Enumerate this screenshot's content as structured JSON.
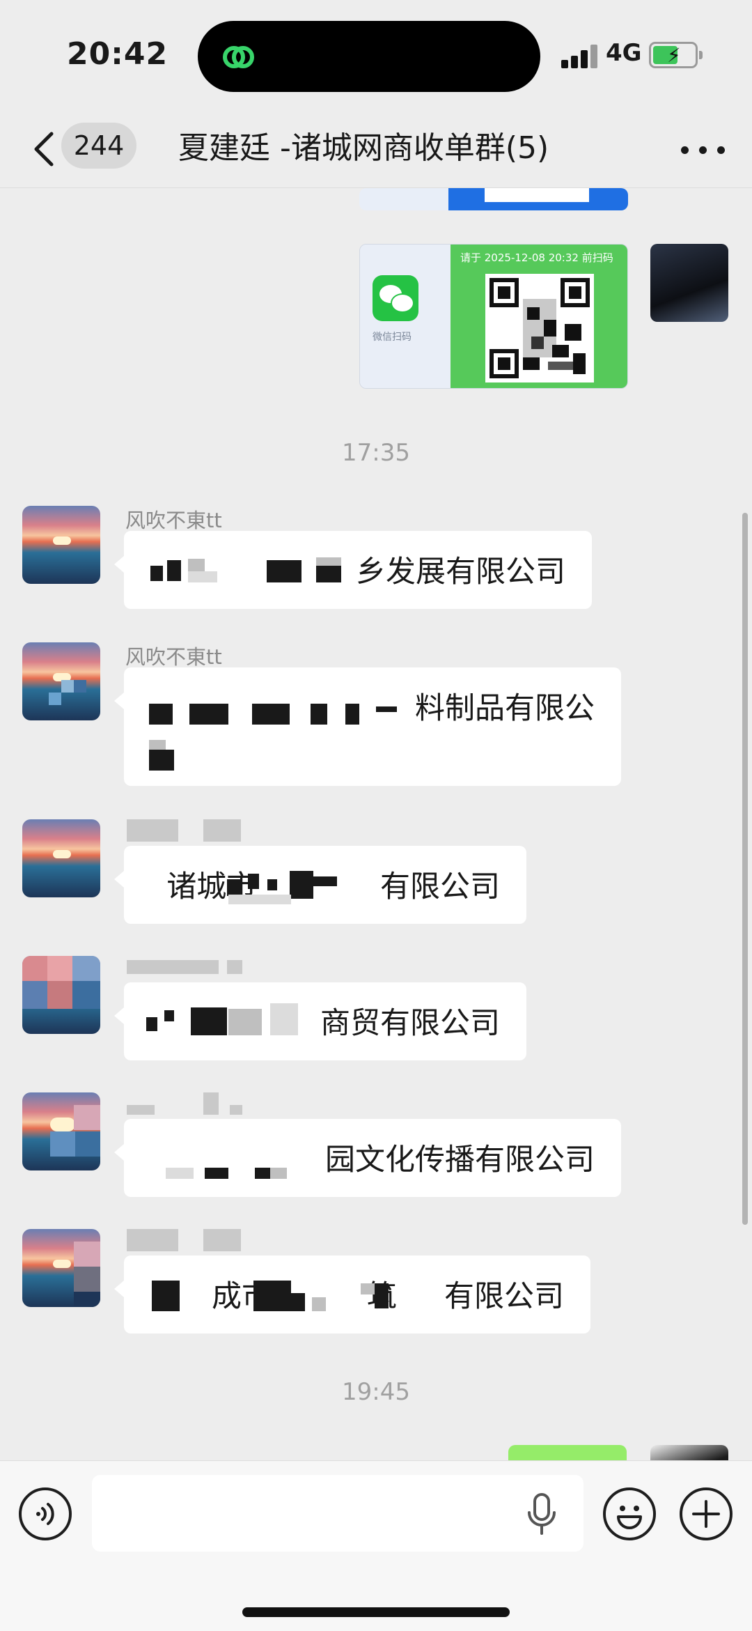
{
  "status_bar": {
    "time": "20:42",
    "network": "4G",
    "battery_level": 0.6,
    "battery_charging": true
  },
  "nav": {
    "unread_count": "244",
    "title": "夏建廷 -诸城网商收单群(5)",
    "icons": [
      "chevron-left-icon",
      "more-dots-icon"
    ]
  },
  "qr_card": {
    "scan_label": "微信扫码",
    "hint": "请于 2025-12-08 20:32 前扫码"
  },
  "timestamps": [
    "17:35",
    "19:45"
  ],
  "messages": [
    {
      "sender": "风吹不東tt",
      "text": "乡发展有限公司"
    },
    {
      "sender": "风吹不東tt",
      "text": "料制品有限公"
    },
    {
      "sender": "",
      "text": "诸城市             有限公司"
    },
    {
      "sender": "",
      "text": "商贸有限公司"
    },
    {
      "sender": "",
      "text": "园文化传播有限公司"
    },
    {
      "sender": "",
      "text": "成市          筑     有限公司"
    }
  ],
  "input_bar": {
    "placeholder": "",
    "icons": [
      "voice-icon",
      "mic-icon",
      "emoji-icon",
      "plus-icon"
    ]
  },
  "colors": {
    "background": "#ededed",
    "bubble_in": "#ffffff",
    "bubble_out": "#95ec69",
    "wechat_green": "#25c244",
    "qr_panel": "#56c95a"
  }
}
